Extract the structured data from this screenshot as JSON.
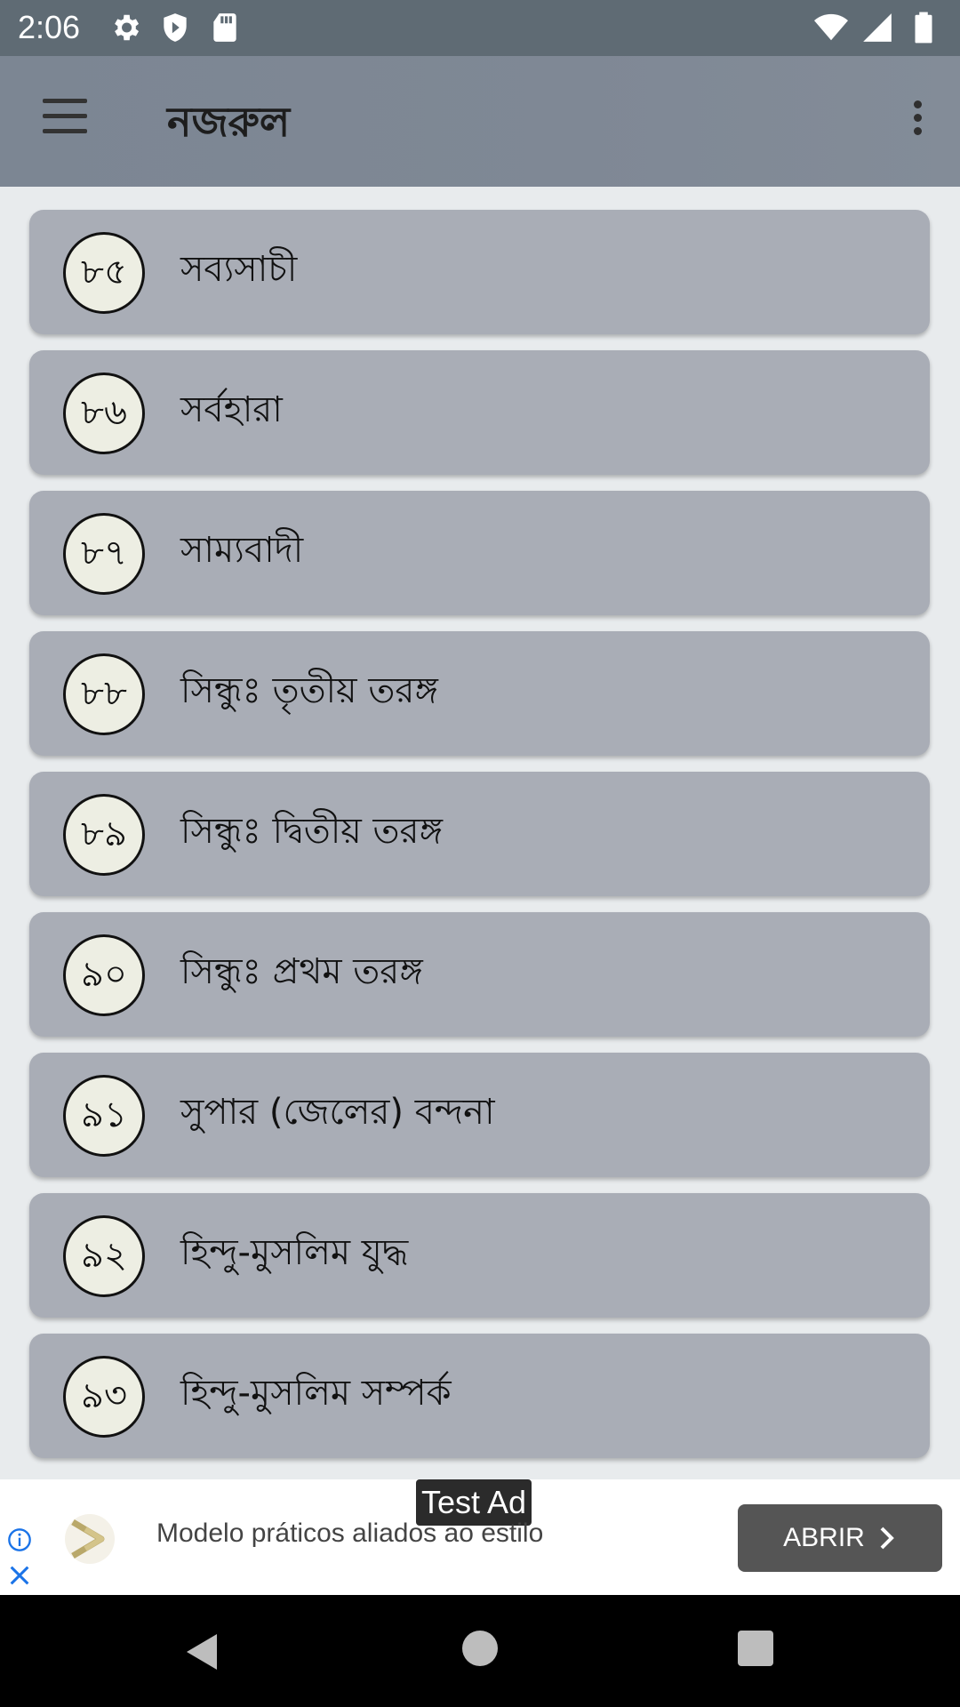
{
  "status_bar": {
    "time": "2:06",
    "left_icons": [
      "settings-icon",
      "shield-icon",
      "sd-card-icon"
    ],
    "right_icons": [
      "wifi-icon",
      "signal-icon",
      "battery-icon"
    ]
  },
  "app_bar": {
    "title": "নজরুল",
    "menu_icon": "menu-icon",
    "overflow_icon": "more-vert-icon"
  },
  "list": {
    "items": [
      {
        "number": "৮৫",
        "title": "সব্যসাচী"
      },
      {
        "number": "৮৬",
        "title": "সর্বহারা"
      },
      {
        "number": "৮৭",
        "title": "সাম্যবাদী"
      },
      {
        "number": "৮৮",
        "title": "সিন্ধুঃ তৃতীয় তরঙ্গ"
      },
      {
        "number": "৮৯",
        "title": "সিন্ধুঃ দ্বিতীয় তরঙ্গ"
      },
      {
        "number": "৯০",
        "title": "সিন্ধুঃ প্রথম তরঙ্গ"
      },
      {
        "number": "৯১",
        "title": "সুপার (জেলের) বন্দনা"
      },
      {
        "number": "৯২",
        "title": "হিন্দু-মুসলিম যুদ্ধ"
      },
      {
        "number": "৯৩",
        "title": "হিন্দু-মুসলিম সম্পর্ক"
      }
    ]
  },
  "ad": {
    "tag": "Test Ad",
    "text": "Modelo práticos aliados ao estilo",
    "button_label": "ABRIR"
  },
  "colors": {
    "status_bar": "#5f6b74",
    "app_bar": "#7f8895",
    "card": "#a9adb6",
    "circle_fill": "#edeee3",
    "ad_button": "#555555"
  }
}
